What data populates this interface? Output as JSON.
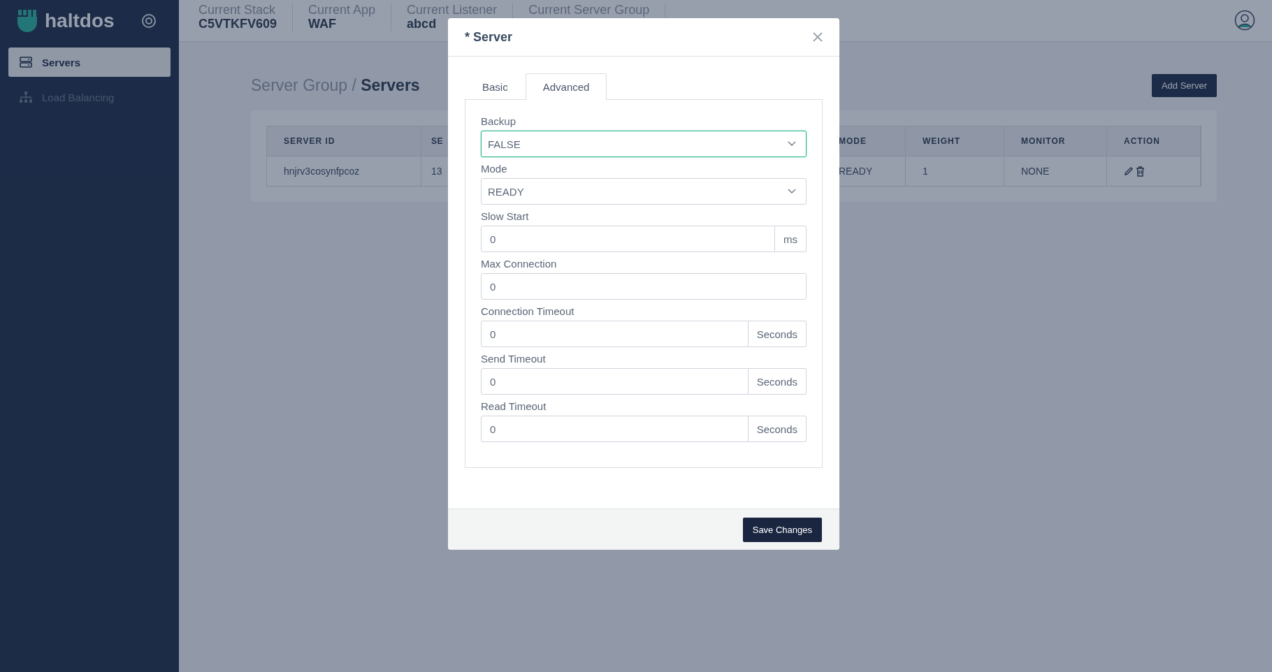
{
  "brand": {
    "name": "haltdos"
  },
  "sidebar": {
    "items": [
      {
        "label": "Servers",
        "selected": true
      },
      {
        "label": "Load Balancing",
        "selected": false
      }
    ]
  },
  "context_bar": [
    {
      "label": "Current Stack",
      "value": "C5VTKFV609"
    },
    {
      "label": "Current App",
      "value": "WAF"
    },
    {
      "label": "Current Listener",
      "value": "abcd"
    },
    {
      "label": "Current Server Group"
    }
  ],
  "breadcrumb": {
    "parent": "Server Group /",
    "current": "Servers"
  },
  "add_button": "Add Server",
  "table": {
    "columns": [
      "SERVER ID",
      "SE",
      "MODE",
      "WEIGHT",
      "MONITOR",
      "ACTION"
    ],
    "rows": [
      {
        "cells": [
          "hnjrv3cosynfpcoz",
          "13",
          "READY",
          "1",
          "NONE"
        ]
      }
    ]
  },
  "modal": {
    "title": "* Server",
    "tabs": [
      {
        "label": "Basic",
        "selected": false
      },
      {
        "label": "Advanced",
        "selected": true
      }
    ],
    "fields": [
      {
        "kind": "select",
        "label": "Backup",
        "value": "FALSE",
        "focused": true
      },
      {
        "kind": "select",
        "label": "Mode",
        "value": "READY",
        "focused": false
      },
      {
        "kind": "addon",
        "label": "Slow Start",
        "value": "0",
        "unit": "ms",
        "focused": false
      },
      {
        "kind": "input",
        "label": "Max Connection",
        "value": "0",
        "focused": false
      },
      {
        "kind": "addon",
        "label": "Connection Timeout",
        "value": "0",
        "unit": "Seconds",
        "focused": false
      },
      {
        "kind": "addon",
        "label": "Send Timeout",
        "value": "0",
        "unit": "Seconds",
        "focused": false
      },
      {
        "kind": "addon",
        "label": "Read Timeout",
        "value": "0",
        "unit": "Seconds",
        "focused": false
      }
    ],
    "save_button": "Save Changes"
  }
}
